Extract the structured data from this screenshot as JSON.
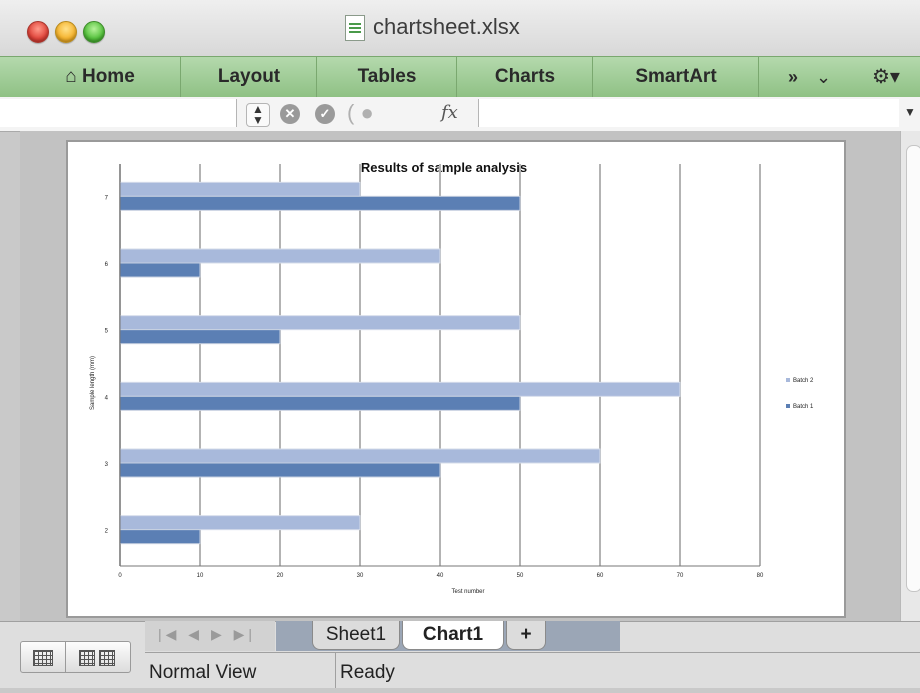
{
  "window": {
    "title": "chartsheet.xlsx"
  },
  "ribbon": {
    "tabs": [
      {
        "label": "Home"
      },
      {
        "label": "Layout"
      },
      {
        "label": "Tables"
      },
      {
        "label": "Charts"
      },
      {
        "label": "SmartArt"
      }
    ],
    "more_label": "»"
  },
  "formula_bar": {
    "fx_label": "fx",
    "name_box_value": "",
    "formula_value": ""
  },
  "colors": {
    "ribbon": "#9fcd95",
    "batch1": "#5b7fb4",
    "batch2": "#a8b9db"
  },
  "chart_data": {
    "type": "bar",
    "orientation": "horizontal",
    "title": "Results of sample analysis",
    "xlabel": "Test number",
    "ylabel": "Sample length (mm)",
    "categories": [
      "2",
      "3",
      "4",
      "5",
      "6",
      "7"
    ],
    "series": [
      {
        "name": "Batch 1",
        "values": [
          10,
          40,
          50,
          20,
          10,
          50
        ]
      },
      {
        "name": "Batch 2",
        "values": [
          30,
          60,
          70,
          50,
          40,
          30
        ]
      }
    ],
    "xlim": [
      0,
      80
    ],
    "xticks": [
      "0",
      "10",
      "20",
      "30",
      "40",
      "50",
      "60",
      "70",
      "80"
    ],
    "grid": "vertical",
    "legend_position": "right"
  },
  "sheet_tabs": [
    {
      "label": "Sheet1"
    },
    {
      "label": "Chart1"
    },
    {
      "label": "+"
    }
  ],
  "status": {
    "view": "Normal View",
    "state": "Ready"
  }
}
